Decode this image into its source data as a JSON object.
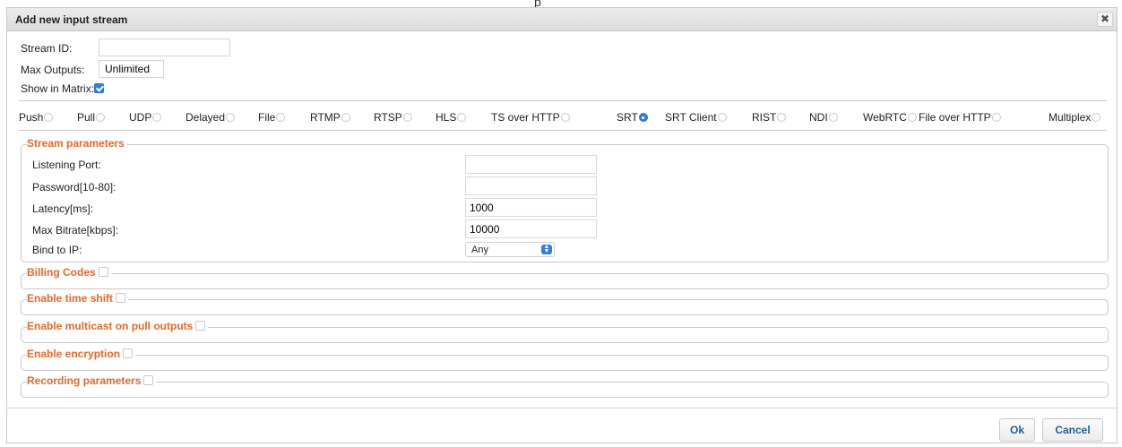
{
  "dialog": {
    "title": "Add new input stream",
    "close_glyph": "✖"
  },
  "form": {
    "stream_id_label": "Stream ID:",
    "stream_id_value": "",
    "max_outputs_label": "Max Outputs:",
    "max_outputs_value": "Unlimited",
    "show_in_matrix_label": "Show in Matrix:",
    "show_in_matrix_checked": true
  },
  "stream_types": {
    "selected": "SRT",
    "items": [
      "Push",
      "Pull",
      "UDP",
      "Delayed",
      "File",
      "RTMP",
      "RTSP",
      "HLS",
      "TS over HTTP",
      "SRT",
      "SRT Client",
      "RIST",
      "NDI",
      "WebRTC",
      "File over HTTP",
      "Multiplex"
    ]
  },
  "stream_parameters": {
    "legend": "Stream parameters",
    "listening_port_label": "Listening Port:",
    "listening_port_value": "",
    "password_label": "Password[10-80]:",
    "password_value": "",
    "latency_label": "Latency[ms]:",
    "latency_value": "1000",
    "max_bitrate_label": "Max Bitrate[kbps]:",
    "max_bitrate_value": "10000",
    "bind_ip_label": "Bind to IP:",
    "bind_ip_value": "Any"
  },
  "sections": {
    "billing_codes": "Billing Codes",
    "time_shift": "Enable time shift",
    "multicast": "Enable multicast on pull outputs",
    "encryption": "Enable encryption",
    "recording": "Recording parameters"
  },
  "buttons": {
    "ok": "Ok",
    "cancel": "Cancel"
  },
  "colors": {
    "accent_orange": "#e8672a",
    "accent_blue": "#2f7fe0",
    "button_text": "#1d5fa8"
  }
}
